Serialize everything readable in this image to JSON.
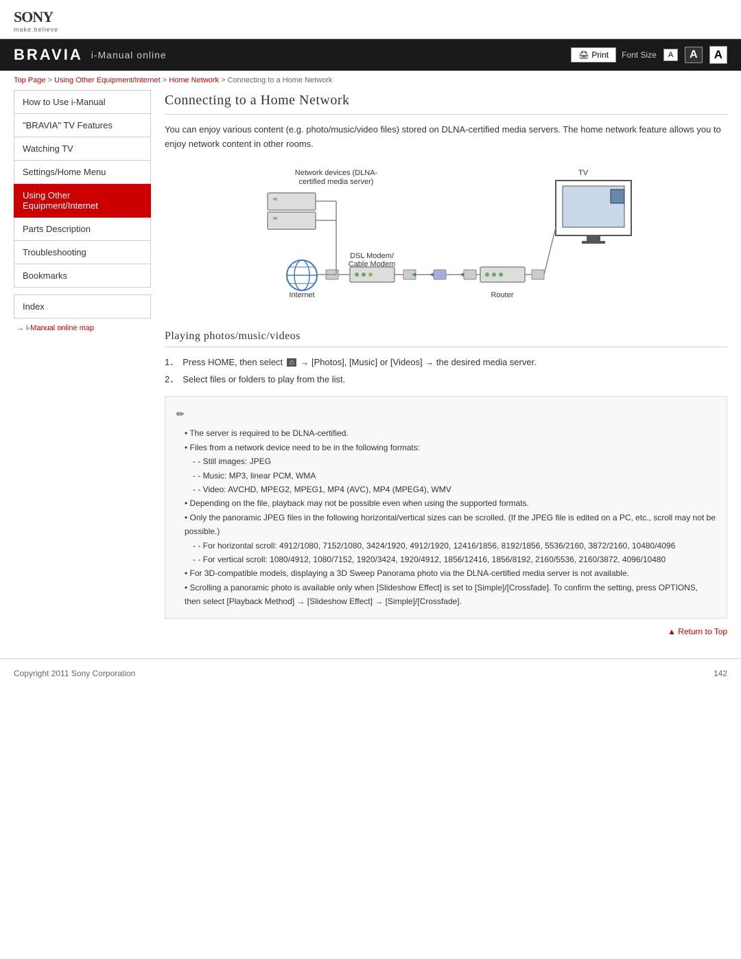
{
  "header": {
    "sony_logo": "SONY",
    "sony_tagline": "make.believe"
  },
  "navbar": {
    "bravia": "BRAVIA",
    "imanual": "i-Manual online",
    "print_label": "Print",
    "font_size_label": "Font Size",
    "font_small": "A",
    "font_medium": "A",
    "font_large": "A"
  },
  "breadcrumb": {
    "top": "Top Page",
    "sep1": " > ",
    "crumb2": "Using Other Equipment/Internet",
    "sep2": " > ",
    "crumb3": "Home Network",
    "sep3": " > ",
    "crumb4": "Connecting to a Home Network"
  },
  "sidebar": {
    "items": [
      {
        "label": "How to Use i-Manual",
        "active": false
      },
      {
        "label": "\"BRAVIA\" TV Features",
        "active": false
      },
      {
        "label": "Watching TV",
        "active": false
      },
      {
        "label": "Settings/Home Menu",
        "active": false
      },
      {
        "label": "Using Other Equipment/Internet",
        "active": true
      },
      {
        "label": "Parts Description",
        "active": false
      },
      {
        "label": "Troubleshooting",
        "active": false
      },
      {
        "label": "Bookmarks",
        "active": false
      }
    ],
    "index_label": "Index",
    "map_link": "i-Manual online map"
  },
  "content": {
    "page_title": "Connecting to a Home Network",
    "intro": "You can enjoy various content (e.g. photo/music/video files) stored on DLNA-certified media servers. The home network feature allows you to enjoy network content in other rooms.",
    "diagram_labels": {
      "network_devices": "Network devices (DLNA-\ncertified media server)",
      "tv": "TV",
      "dsl_modem": "DSL Modem/\nCable Modem",
      "internet": "Internet",
      "router": "Router"
    },
    "section_title": "Playing photos/music/videos",
    "steps": [
      {
        "num": "1．",
        "text": "Press HOME, then select"
      },
      {
        "num": "2．",
        "text": "Select files or folders to play from the list."
      }
    ],
    "step1_suffix": " → [Photos], [Music] or [Videos] → the desired media server.",
    "note": {
      "bullets": [
        "The server is required to be DLNA-certified.",
        "Files from a network device need to be in the following formats:",
        "Depending on the file, playback may not be possible even when using the supported formats.",
        "Only the panoramic JPEG files in the following horizontal/vertical sizes can be scrolled. (If the JPEG file is edited on a PC, etc., scroll may not be possible.)",
        "For 3D-compatible models, displaying a 3D Sweep Panorama photo via the DLNA-certified media server is not available.",
        "Scrolling a panoramic photo is available only when [Slideshow Effect] is set to [Simple]/[Crossfade]. To confirm the setting, press OPTIONS, then select [Playback Method] → [Slideshow Effect] → [Simple]/[Crossfade]."
      ],
      "sub1": [
        "- Still images: JPEG",
        "- Music: MP3, linear PCM, WMA",
        "- Video: AVCHD, MPEG2, MPEG1, MP4 (AVC), MP4 (MPEG4), WMV"
      ],
      "sub2": [
        "- For horizontal scroll: 4912/1080, 7152/1080, 3424/1920, 4912/1920, 12416/1856, 8192/1856, 5536/2160, 3872/2160, 10480/4096",
        "- For vertical scroll: 1080/4912, 1080/7152, 1920/3424, 1920/4912, 1856/12416, 1856/8192, 2160/5536, 2160/3872, 4096/10480"
      ]
    },
    "return_to_top": "Return to Top"
  },
  "footer": {
    "copyright": "Copyright 2011 Sony Corporation",
    "page_number": "142"
  }
}
